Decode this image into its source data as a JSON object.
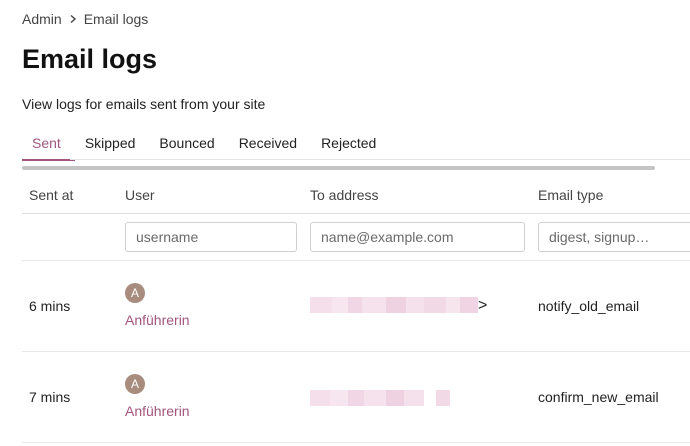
{
  "breadcrumb": {
    "items": [
      {
        "label": "Admin"
      },
      {
        "label": "Email logs"
      }
    ]
  },
  "page": {
    "title": "Email logs",
    "subtitle": "View logs for emails sent from your site"
  },
  "tabs": [
    {
      "label": "Sent",
      "active": true
    },
    {
      "label": "Skipped",
      "active": false
    },
    {
      "label": "Bounced",
      "active": false
    },
    {
      "label": "Received",
      "active": false
    },
    {
      "label": "Rejected",
      "active": false
    }
  ],
  "table": {
    "columns": [
      "Sent at",
      "User",
      "To address",
      "Email type"
    ],
    "filters": {
      "user_placeholder": "username",
      "address_placeholder": "name@example.com",
      "type_placeholder": "digest, signup…"
    },
    "rows": [
      {
        "sent_at": "6 mins",
        "avatar_letter": "A",
        "user": "Anführerin",
        "to_address_redacted": true,
        "email_type": "notify_old_email"
      },
      {
        "sent_at": "7 mins",
        "avatar_letter": "A",
        "user": "Anführerin",
        "to_address_redacted": true,
        "email_type": "confirm_new_email"
      }
    ]
  },
  "colors": {
    "accent": "#a3567f",
    "avatar_bg": "#a88c7d",
    "redaction": "#f1d6e5"
  },
  "icons": {
    "breadcrumb_separator": "chevron-right-icon"
  }
}
